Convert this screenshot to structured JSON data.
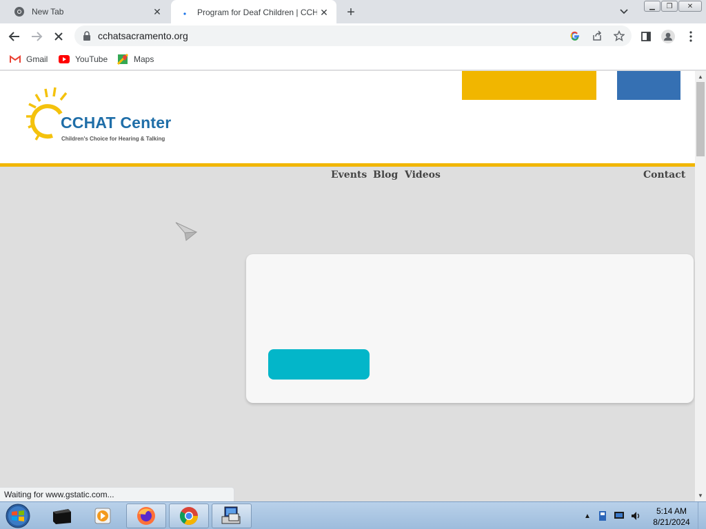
{
  "browser": {
    "tabs": [
      {
        "title": "New Tab",
        "icon": "chrome-icon"
      },
      {
        "title": "Program for Deaf Children | CCHAT",
        "icon": "loading-dot-icon"
      }
    ],
    "url": "cchatsacramento.org",
    "bookmarks": [
      {
        "label": "Gmail",
        "icon": "gmail-icon"
      },
      {
        "label": "YouTube",
        "icon": "youtube-icon"
      },
      {
        "label": "Maps",
        "icon": "maps-icon"
      }
    ],
    "status_text": "Waiting for www.gstatic.com..."
  },
  "site": {
    "logo_name": "CCHAT Center",
    "logo_tagline": "Children's Choice for Hearing & Talking",
    "nav": [
      "Events",
      "Blog",
      "Videos",
      "Contact"
    ],
    "colors": {
      "accent_yellow": "#f1b600",
      "accent_blue": "#3570b3",
      "cta_teal": "#03b6c9"
    }
  },
  "taskbar": {
    "time": "5:14 AM",
    "date": "8/21/2024"
  }
}
